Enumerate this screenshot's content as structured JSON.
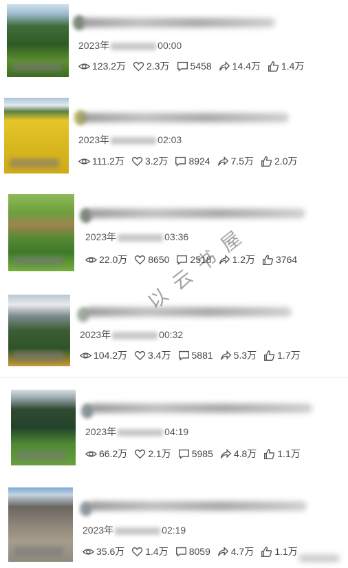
{
  "watermark": "以 云 书 屋",
  "items": [
    {
      "date_prefix": "2023年",
      "time": "00:00",
      "views": "123.2万",
      "likes": "2.3万",
      "comments": "5458",
      "shares": "14.4万",
      "thumbs": "1.4万"
    },
    {
      "date_prefix": "2023年",
      "time": "02:03",
      "views": "111.2万",
      "likes": "3.2万",
      "comments": "8924",
      "shares": "7.5万",
      "thumbs": "2.0万"
    },
    {
      "date_prefix": "2023年",
      "time": "03:36",
      "views": "22.0万",
      "likes": "8650",
      "comments": "2518",
      "shares": "1.2万",
      "thumbs": "3764"
    },
    {
      "date_prefix": "2023年",
      "time": "00:32",
      "views": "104.2万",
      "likes": "3.4万",
      "comments": "5881",
      "shares": "5.3万",
      "thumbs": "1.7万"
    },
    {
      "date_prefix": "2023年",
      "time": "04:19",
      "views": "66.2万",
      "likes": "2.1万",
      "comments": "5985",
      "shares": "4.8万",
      "thumbs": "1.1万"
    },
    {
      "date_prefix": "2023年",
      "time": "02:19",
      "views": "35.6万",
      "likes": "1.4万",
      "comments": "8059",
      "shares": "4.7万",
      "thumbs": "1.1万"
    }
  ]
}
